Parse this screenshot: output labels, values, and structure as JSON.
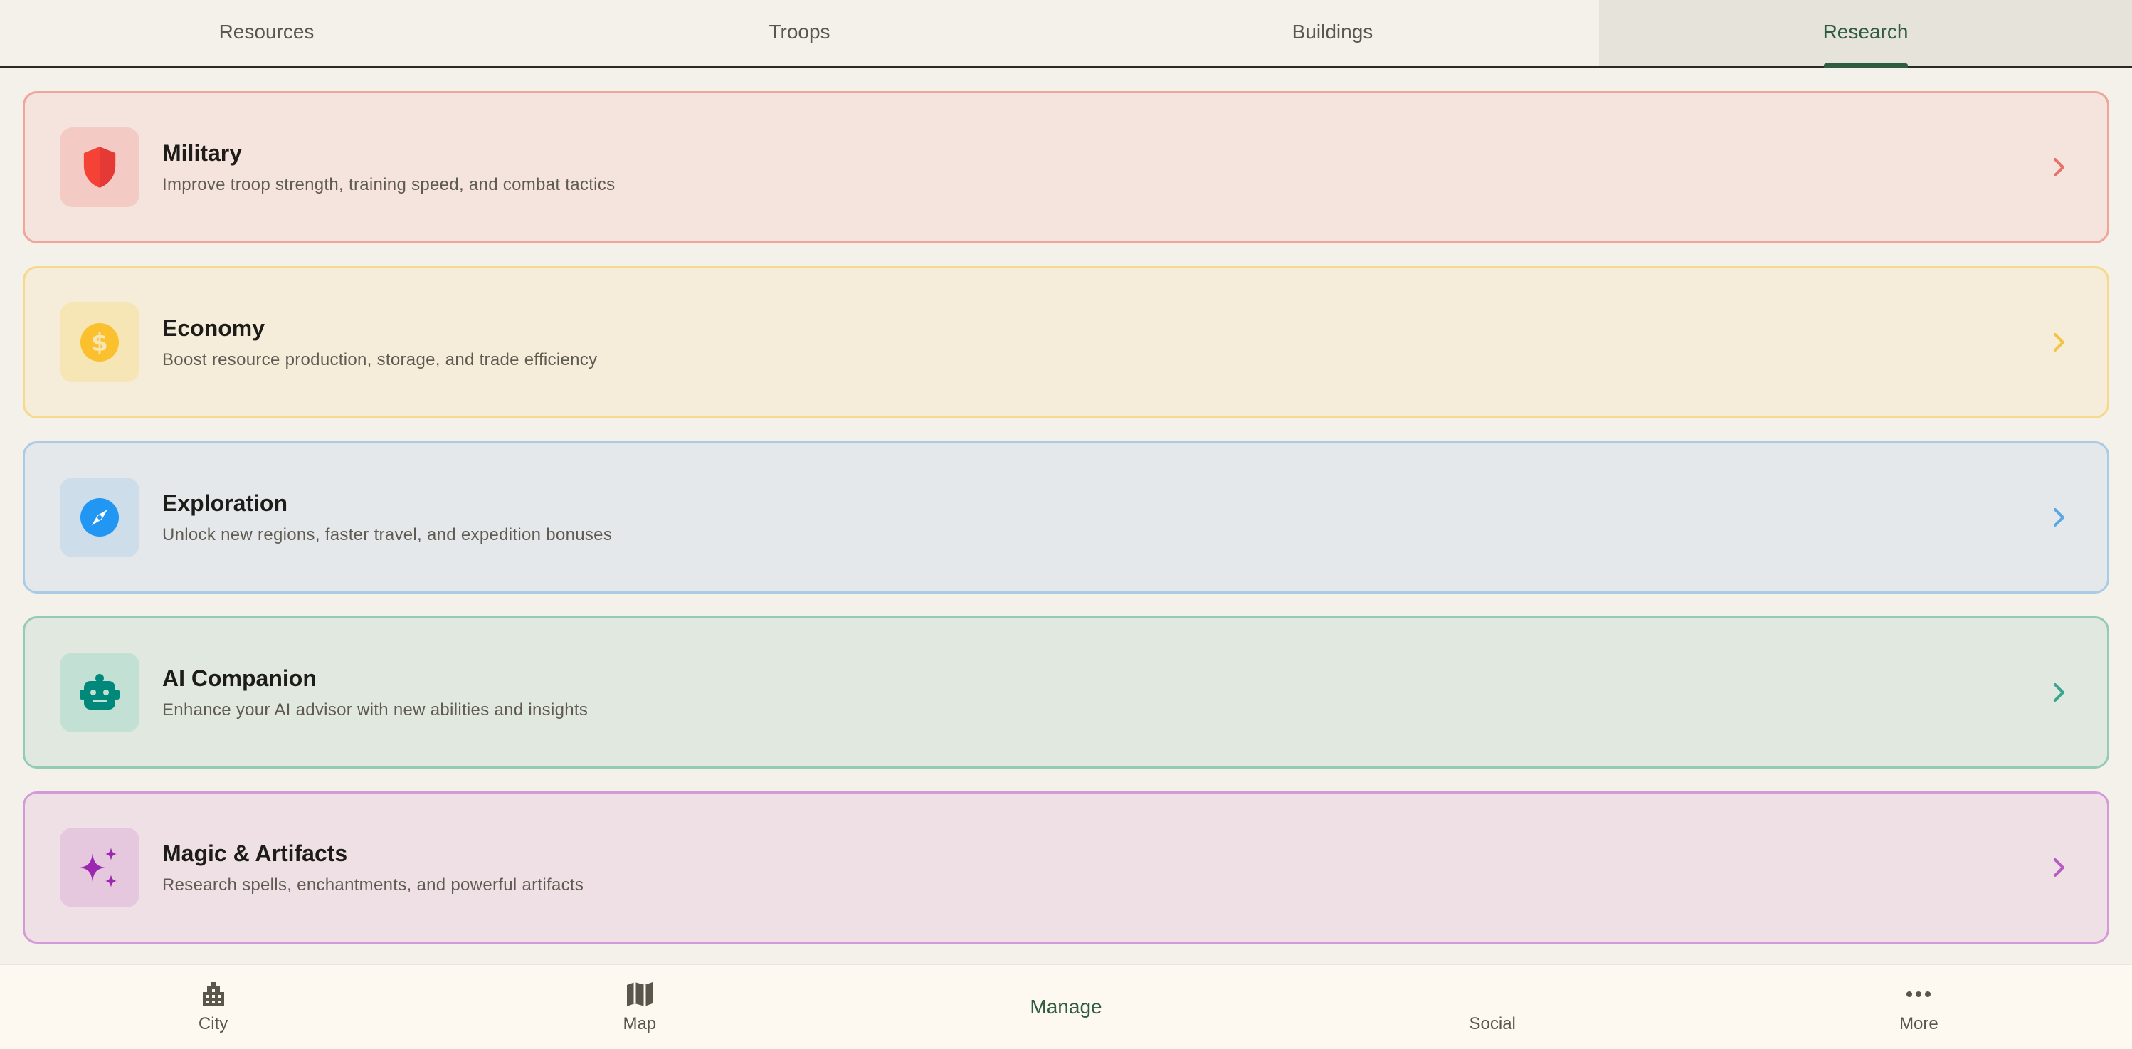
{
  "tabs": [
    {
      "label": "Resources"
    },
    {
      "label": "Troops"
    },
    {
      "label": "Buildings"
    },
    {
      "label": "Research",
      "active": true
    }
  ],
  "categories": [
    {
      "title": "Military",
      "description": "Improve troop strength, training speed, and combat tactics",
      "icon": "shield-icon",
      "accent": "#f44336"
    },
    {
      "title": "Economy",
      "description": "Boost resource production, storage, and trade efficiency",
      "icon": "dollar-coin-icon",
      "accent": "#fbc02d"
    },
    {
      "title": "Exploration",
      "description": "Unlock new regions, faster travel, and expedition bonuses",
      "icon": "compass-icon",
      "accent": "#2196f3"
    },
    {
      "title": "AI Companion",
      "description": "Enhance your AI advisor with new abilities and insights",
      "icon": "robot-icon",
      "accent": "#00897b"
    },
    {
      "title": "Magic & Artifacts",
      "description": "Research spells, enchantments, and powerful artifacts",
      "icon": "sparkles-icon",
      "accent": "#9c27b0"
    }
  ],
  "bottom_nav": [
    {
      "label": "City",
      "icon": "city-icon"
    },
    {
      "label": "Map",
      "icon": "map-icon"
    },
    {
      "label": "Manage",
      "active": true
    },
    {
      "label": "Social"
    },
    {
      "label": "More",
      "icon": "more-dots-icon"
    }
  ]
}
